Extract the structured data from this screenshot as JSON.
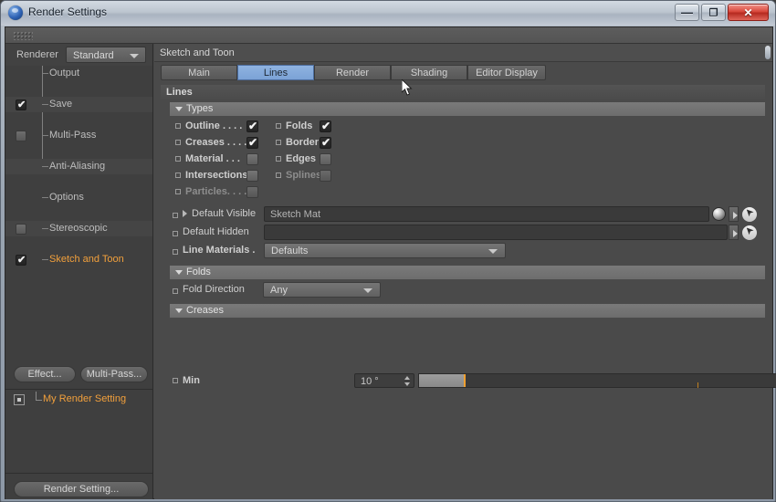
{
  "window": {
    "title": "Render Settings",
    "icon": "c4d-logo-icon",
    "minimize_label": "—",
    "maximize_label": "❐",
    "close_label": "✕"
  },
  "sidebar": {
    "renderer_label": "Renderer",
    "renderer_value": "Standard",
    "tree": [
      {
        "label": "Output",
        "checkbox": "none",
        "selected": false
      },
      {
        "label": "Save",
        "checkbox": "checked",
        "selected": false
      },
      {
        "label": "Multi-Pass",
        "checkbox": "unchecked",
        "selected": false
      },
      {
        "label": "Anti-Aliasing",
        "checkbox": "none",
        "selected": false
      },
      {
        "label": "Options",
        "checkbox": "none",
        "selected": false
      },
      {
        "label": "Stereoscopic",
        "checkbox": "unchecked",
        "selected": false
      },
      {
        "label": "Sketch and Toon",
        "checkbox": "checked",
        "selected": true
      }
    ],
    "effect_button": "Effect...",
    "multipass_button": "Multi-Pass...",
    "render_setting_item": "My Render Setting",
    "render_setting_button": "Render Setting..."
  },
  "main": {
    "title": "Sketch and Toon",
    "tabs": [
      {
        "label": "Main",
        "active": false
      },
      {
        "label": "Lines",
        "active": true
      },
      {
        "label": "Render",
        "active": false
      },
      {
        "label": "Shading",
        "active": false
      },
      {
        "label": "Editor Display",
        "active": false
      }
    ],
    "section_header": "Lines",
    "groups": {
      "types": "Types",
      "folds": "Folds",
      "creases": "Creases"
    },
    "types": {
      "col_left": [
        {
          "label": "Outline . . . .",
          "state": "checked",
          "dim": false
        },
        {
          "label": "Creases . . . .",
          "state": "checked",
          "dim": false
        },
        {
          "label": "Material . . .",
          "state": "unchecked",
          "dim": false
        },
        {
          "label": "Intersections",
          "state": "unchecked",
          "dim": false
        },
        {
          "label": "Particles. . . .",
          "state": "unchecked",
          "dim": true
        }
      ],
      "col_right": [
        {
          "label": "Folds",
          "state": "checked",
          "dim": false
        },
        {
          "label": "Border",
          "state": "checked",
          "dim": false
        },
        {
          "label": "Edges",
          "state": "unchecked",
          "dim": false
        },
        {
          "label": "Splines",
          "state": "unchecked",
          "dim": true
        }
      ]
    },
    "materials": {
      "default_visible_label": "Default Visible",
      "default_visible_value": "Sketch Mat",
      "default_hidden_label": "Default Hidden",
      "default_hidden_value": "",
      "line_materials_label": "Line Materials .",
      "line_materials_value": "Defaults"
    },
    "folds": {
      "fold_direction_label": "Fold Direction",
      "fold_direction_value": "Any"
    },
    "creases": {
      "min_label": "Min",
      "min_value": "10 °",
      "slider_percent": 9
    }
  },
  "colors": {
    "accent_selected": "#f2a03c",
    "tab_active": "#8fb3e0",
    "slider_handle": "#f0a030",
    "panel_bg": "#4a4a4a",
    "sidebar_bg": "#3f3f3f"
  }
}
